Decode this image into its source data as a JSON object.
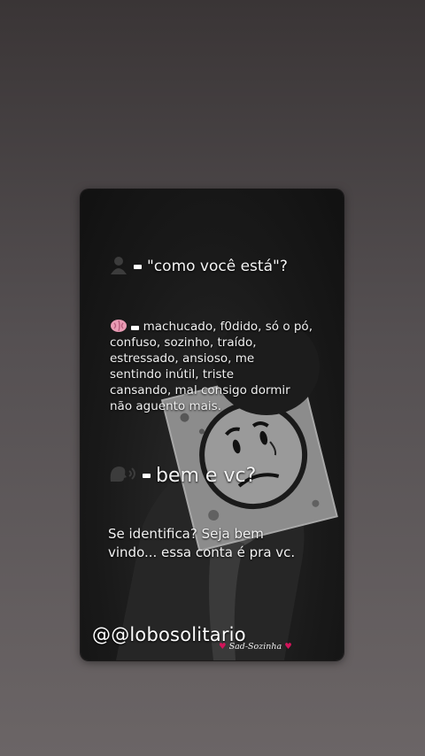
{
  "question": {
    "icon": "person-silhouette-icon",
    "text": "\"como você está\"?"
  },
  "answer": {
    "icon": "brain-icon",
    "lines": [
      "machucado, f0dido, só o pó,",
      "confuso, sozinho, traído,",
      "estressado, ansioso, me",
      "sentindo inútil, triste",
      "cansando, mal consigo dormir",
      "não aguento mais."
    ]
  },
  "reply": {
    "icon": "speaking-head-icon",
    "text": "bem e vc?"
  },
  "welcome": {
    "lines": [
      "Se identifica? Seja bem",
      "vindo... essa conta é pra vc."
    ]
  },
  "handle": "@@lobosolitario",
  "signature": "Sad-Sozinha",
  "colors": {
    "background": "#4a4546",
    "card": "#1a1a1a",
    "text": "#f4f4f4",
    "accent_heart": "#d2145a"
  }
}
